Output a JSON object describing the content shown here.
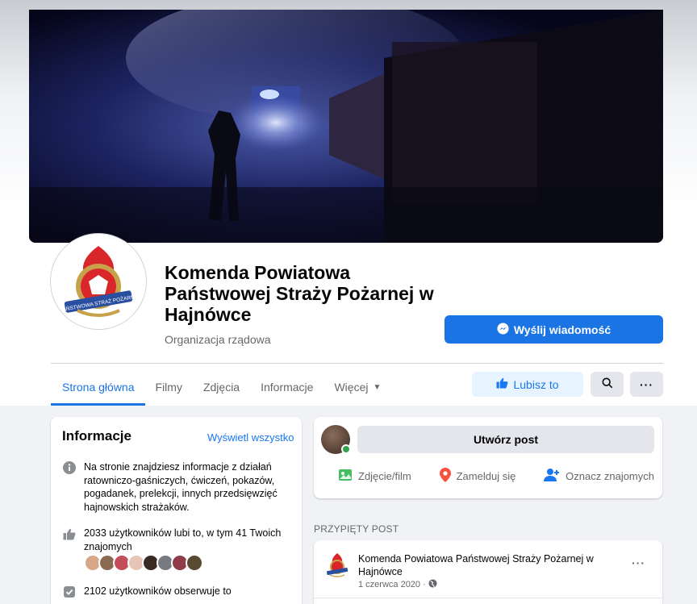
{
  "page": {
    "name": "Komenda Powiatowa Państwowej Straży Pożarnej w Hajnówce",
    "category": "Organizacja rządowa",
    "logo_text": "PAŃSTWOWA STRAŻ POŻARNA",
    "send_message_label": "Wyślij wiadomość"
  },
  "tabs": [
    {
      "label": "Strona główna"
    },
    {
      "label": "Filmy"
    },
    {
      "label": "Zdjęcia"
    },
    {
      "label": "Informacje"
    },
    {
      "label": "Więcej"
    }
  ],
  "actions": {
    "like_label": "Lubisz to",
    "search_icon": "search-icon",
    "more_icon": "more-icon"
  },
  "info": {
    "title": "Informacje",
    "see_all": "Wyświetl wszystko",
    "about": "Na stronie znajdziesz informacje z działań ratowniczo-gaśniczych, ćwiczeń, pokazów, pogadanek, prelekcji, innych przedsięwzięć hajnowskich strażaków.",
    "likes": "2033 użytkowników lubi to, w tym 41 Twoich znajomych",
    "follows": "2102 użytkowników obserwuje to"
  },
  "create_post": {
    "prompt": "Utwórz post",
    "photo": "Zdjęcie/film",
    "checkin": "Zamelduj się",
    "tag": "Oznacz znajomych"
  },
  "pinned": {
    "label": "PRZYPIĘTY POST",
    "author": "Komenda Powiatowa Państwowej Straży Pożarnej w Hajnówce",
    "date": "1 czerwca 2020 ·"
  },
  "colors": {
    "accent": "#1b74e4",
    "like_bg": "#e7f3ff",
    "online": "#31a24c"
  }
}
